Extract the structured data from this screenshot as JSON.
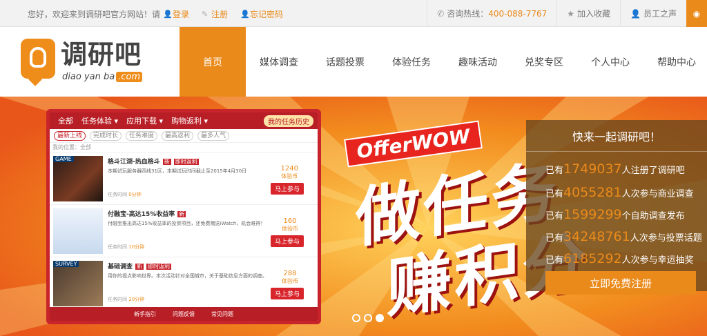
{
  "topbar": {
    "welcome": "您好，欢迎来到调研吧官方网站！请",
    "login": "登录",
    "register": "注册",
    "forgot": "忘记密码",
    "hotline_label": "咨询热线：",
    "hotline_number": "400-088-7767",
    "favorite": "加入收藏",
    "staff": "员工之声"
  },
  "logo": {
    "cn": "调研吧",
    "en": "diao yan ba",
    "com": ".com"
  },
  "nav": {
    "home": "首页",
    "items": [
      "媒体调查",
      "话题投票",
      "体验任务",
      "趣味活动",
      "兑奖专区",
      "个人中心",
      "帮助中心"
    ]
  },
  "phone": {
    "tabs": [
      "全部",
      "任务体验 ▾",
      "应用下载 ▾",
      "购物返利 ▾"
    ],
    "history": "我的任务历史",
    "filters": [
      "最新上线",
      "完成时长",
      "任务难度",
      "最高返利",
      "最多人气"
    ],
    "crumb": "我的位置：全部",
    "tasks": [
      {
        "tag": "GAME",
        "title": "格斗江湖-热血格斗",
        "badge": "新",
        "badge2": "即时返利",
        "desc": "本期试玩服务器四线31区，本期试玩时间截止至2015年4月30日",
        "time_label": "任务时间",
        "time": "0分钟",
        "pts": "1240",
        "unit": "体验币",
        "go": "马上参与"
      },
      {
        "tag": "",
        "title": "付融宝-高达15%收益率",
        "badge": "新",
        "badge2": "",
        "desc": "付融宝推出高达15%收益率的投资项目，还免费赠送iWatch，机会难得！",
        "time_label": "任务时间",
        "time": "10分钟",
        "pts": "160",
        "unit": "体验币",
        "go": "马上参与"
      },
      {
        "tag": "SURVEY",
        "title": "基础调查",
        "badge": "新",
        "badge2": "即时返利",
        "desc": "用你的视点影响世界。本次活动针对全国城市，关于基础信息方面的调查。",
        "time_label": "任务时间",
        "time": "20分钟",
        "pts": "288",
        "unit": "体验币",
        "go": "马上参与"
      }
    ],
    "footer": [
      "新手指引",
      "问题反馈",
      "常见问题"
    ]
  },
  "banner": {
    "brand": "OfferWOW",
    "line1": "做任务",
    "line2": "赚积分"
  },
  "stats": {
    "title": "快来一起调研吧！",
    "rows": [
      {
        "prefix": "已有",
        "num": "1749037",
        "suffix": "人注册了调研吧"
      },
      {
        "prefix": "已有",
        "num": "4055281",
        "suffix": "人次参与商业调查"
      },
      {
        "prefix": "已有",
        "num": "1599299",
        "suffix": "个自助调查发布"
      },
      {
        "prefix": "已有",
        "num": "34248761",
        "suffix": "人次参与投票话题"
      },
      {
        "prefix": "已有",
        "num": "6185292",
        "suffix": "人次参与幸运抽奖"
      }
    ],
    "cta": "立即免费注册"
  },
  "colors": {
    "accent": "#ea8a1a",
    "banner_red": "#c7242b"
  }
}
